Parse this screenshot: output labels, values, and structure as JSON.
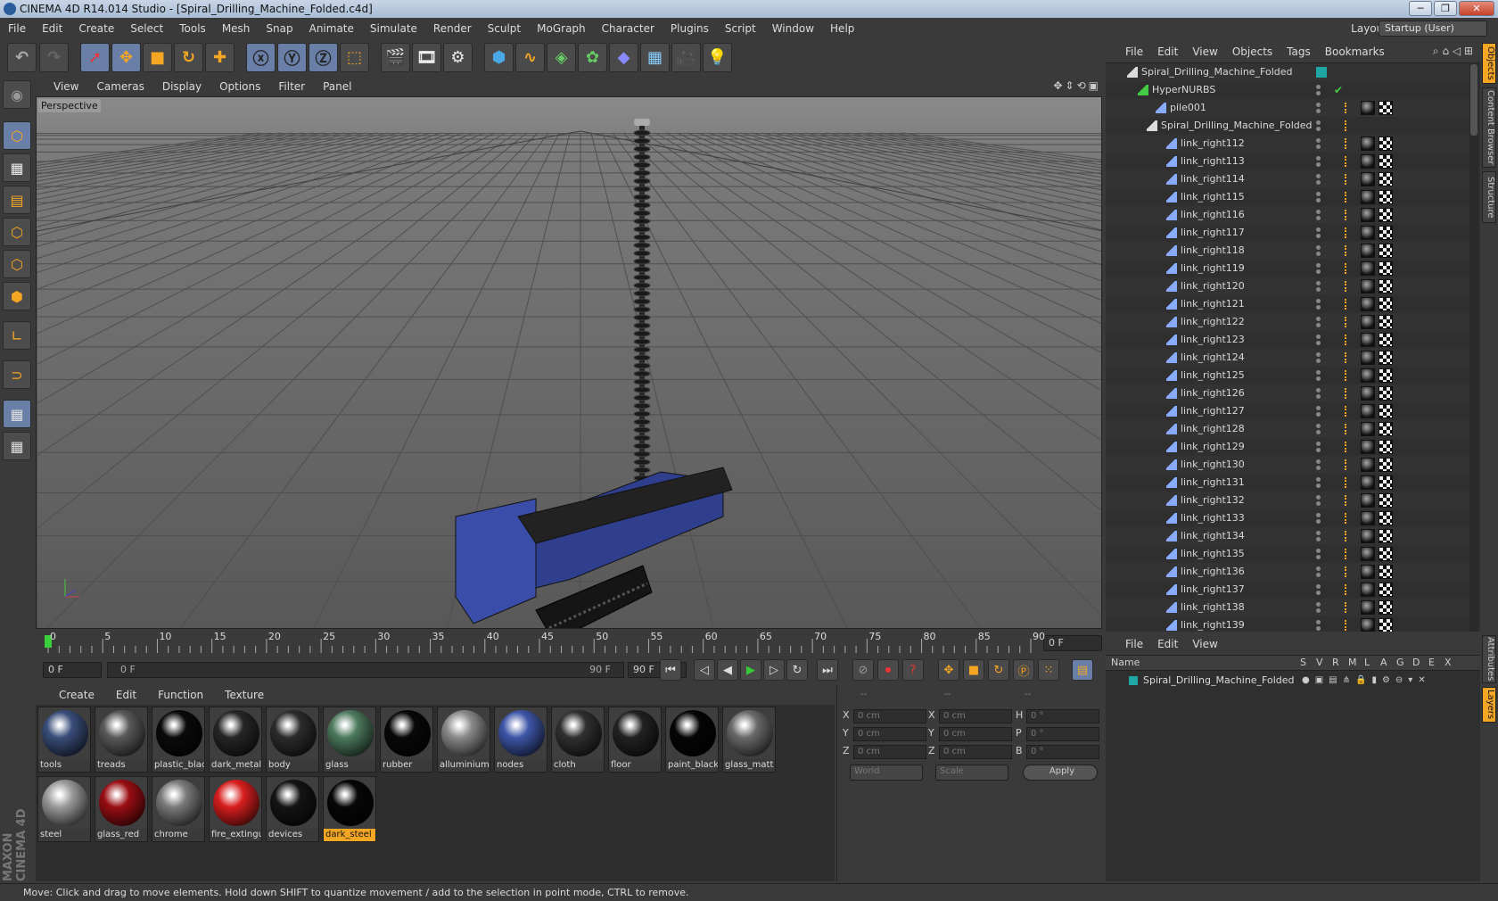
{
  "window": {
    "title": "CINEMA 4D R14.014 Studio - [Spiral_Drilling_Machine_Folded.c4d]"
  },
  "menu": [
    "File",
    "Edit",
    "Create",
    "Select",
    "Tools",
    "Mesh",
    "Snap",
    "Animate",
    "Simulate",
    "Render",
    "Sculpt",
    "MoGraph",
    "Character",
    "Plugins",
    "Script",
    "Window",
    "Help"
  ],
  "layout": {
    "label": "Layout:",
    "value": "Startup (User)"
  },
  "viewport": {
    "menu": [
      "View",
      "Cameras",
      "Display",
      "Options",
      "Filter",
      "Panel"
    ],
    "label": "Perspective"
  },
  "timeline": {
    "ticks": [
      "0",
      "5",
      "10",
      "15",
      "20",
      "25",
      "30",
      "35",
      "40",
      "45",
      "50",
      "55",
      "60",
      "65",
      "70",
      "75",
      "80",
      "85",
      "90"
    ],
    "current": "0 F"
  },
  "timecontrols": {
    "start": "0 F",
    "range_start": "0 F",
    "range_end": "90 F",
    "end": "90 F"
  },
  "materials": {
    "menu": [
      "Create",
      "Edit",
      "Function",
      "Texture"
    ],
    "items": [
      {
        "name": "tools",
        "color": "#3a4e7a"
      },
      {
        "name": "treads",
        "color": "#5a5a5a"
      },
      {
        "name": "plastic_blac",
        "color": "#0a0a0a"
      },
      {
        "name": "dark_metal",
        "color": "#262626"
      },
      {
        "name": "body",
        "color": "#2c2c2c"
      },
      {
        "name": "glass",
        "color": "#4d7a5e"
      },
      {
        "name": "rubber",
        "color": "#080808"
      },
      {
        "name": "alluminium",
        "color": "#8a8a8a"
      },
      {
        "name": "nodes",
        "color": "#3e56a8"
      },
      {
        "name": "cloth",
        "color": "#303030"
      },
      {
        "name": "floor",
        "color": "#222222"
      },
      {
        "name": "paint_black",
        "color": "#050505"
      },
      {
        "name": "glass_matt",
        "color": "#6a6a6a"
      },
      {
        "name": "steel",
        "color": "#9a9a9a"
      },
      {
        "name": "glass_red",
        "color": "#9a0e14"
      },
      {
        "name": "chrome",
        "color": "#7a7a7a"
      },
      {
        "name": "fire_extingu",
        "color": "#d81e1e"
      },
      {
        "name": "devices",
        "color": "#141414"
      },
      {
        "name": "dark_steel",
        "color": "#060606"
      }
    ],
    "selected": "dark_steel"
  },
  "coords": {
    "header": [
      "--",
      "--",
      "--"
    ],
    "rows": [
      {
        "a": "X",
        "av": "0 cm",
        "b": "X",
        "bv": "0 cm",
        "c": "H",
        "cv": "0 °"
      },
      {
        "a": "Y",
        "av": "0 cm",
        "b": "Y",
        "bv": "0 cm",
        "c": "P",
        "cv": "0 °"
      },
      {
        "a": "Z",
        "av": "0 cm",
        "b": "Z",
        "bv": "0 cm",
        "c": "B",
        "cv": "0 °"
      }
    ],
    "mode1": "World",
    "mode2": "Scale",
    "apply": "Apply"
  },
  "objects": {
    "menu": [
      "File",
      "Edit",
      "View",
      "Objects",
      "Tags",
      "Bookmarks"
    ],
    "root": "Spiral_Drilling_Machine_Folded",
    "hypernurbs": "HyperNURBS",
    "pile": "pile001",
    "group": "Spiral_Drilling_Machine_Folded",
    "links": [
      "link_right112",
      "link_right113",
      "link_right114",
      "link_right115",
      "link_right116",
      "link_right117",
      "link_right118",
      "link_right119",
      "link_right120",
      "link_right121",
      "link_right122",
      "link_right123",
      "link_right124",
      "link_right125",
      "link_right126",
      "link_right127",
      "link_right128",
      "link_right129",
      "link_right130",
      "link_right131",
      "link_right132",
      "link_right133",
      "link_right134",
      "link_right135",
      "link_right136",
      "link_right137",
      "link_right138",
      "link_right139"
    ]
  },
  "layers": {
    "menu": [
      "File",
      "Edit",
      "View"
    ],
    "columns": [
      "Name",
      "S",
      "V",
      "R",
      "M",
      "L",
      "A",
      "G",
      "D",
      "E",
      "X"
    ],
    "item": "Spiral_Drilling_Machine_Folded"
  },
  "sidetabs": [
    "Objects",
    "Content Browser",
    "Structure",
    "Attributes",
    "Layers"
  ],
  "status": "Move: Click and drag to move elements. Hold down SHIFT to quantize movement / add to the selection in point mode, CTRL to remove.",
  "brand": "MAXON CINEMA 4D",
  "colors": {
    "accent": "#f5a623",
    "selection": "#6a7fa8",
    "machine": "#2f3f8e"
  }
}
